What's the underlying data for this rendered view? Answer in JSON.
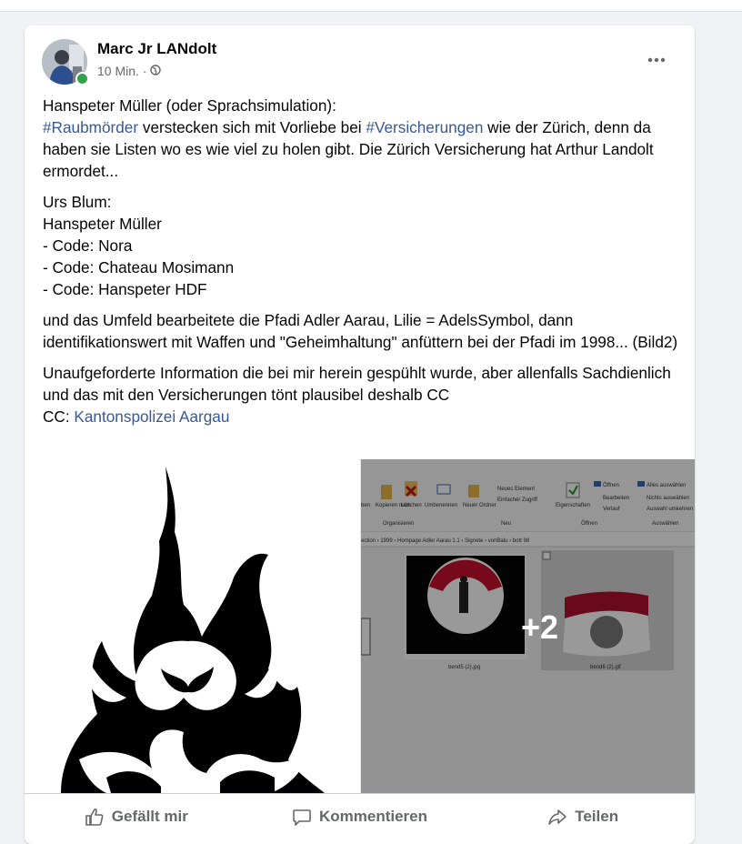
{
  "post": {
    "author": "Marc Jr LANdolt",
    "time": "10 Min. ·",
    "privacy_icon": "globe-icon",
    "paragraphs": [
      [
        {
          "text": "Hanspeter Müller (oder Sprachsimulation):",
          "type": "text"
        },
        {
          "type": "br"
        },
        {
          "text": "#Raubmörder",
          "type": "link"
        },
        {
          "text": " verstecken sich mit Vorliebe bei ",
          "type": "text"
        },
        {
          "text": "#Versicherungen",
          "type": "link"
        },
        {
          "text": " wie der Zürich, denn da haben sie Listen wo es wie viel zu holen gibt. Die Zürich Versicherung hat Arthur Landolt ermordet...",
          "type": "text"
        }
      ],
      [
        {
          "text": "Urs Blum:",
          "type": "text"
        },
        {
          "type": "br"
        },
        {
          "text": "Hanspeter Müller",
          "type": "text"
        },
        {
          "type": "br"
        },
        {
          "text": "- Code: Nora",
          "type": "text"
        },
        {
          "type": "br"
        },
        {
          "text": "- Code: Chateau Mosimann",
          "type": "text"
        },
        {
          "type": "br"
        },
        {
          "text": "- Code: Hanspeter HDF",
          "type": "text"
        }
      ],
      [
        {
          "text": "und das Umfeld bearbeitete die Pfadi Adler Aarau, Lilie = AdelsSymbol, dann identifikationswert mit Waffen und \"Geheimhaltung\" anfüttern bei der Pfadi im 1998... (Bild2)",
          "type": "text"
        }
      ],
      [
        {
          "text": "Unaufgeforderte Information die bei mir herein gespühlt wurde, aber allenfalls Sachdienlich und das mit den Versicherungen tönt plausibel deshalb CC",
          "type": "text"
        },
        {
          "type": "br"
        },
        {
          "text": "CC: ",
          "type": "text"
        },
        {
          "text": "Kantonspolizei Aargau",
          "type": "link"
        }
      ]
    ],
    "more_photos": "+2"
  },
  "screenshot_window": {
    "ribbon_items": [
      "ben",
      "Kopieren nach",
      "Löschen",
      "Umbenennen",
      "Neuer Ordner",
      "Neues Element",
      "Einfacher Zugriff",
      "Eigenschaften",
      "Öffnen",
      "Bearbeiten",
      "Verlauf",
      "Alles auswählen",
      "Nichts auswählen",
      "Auswahl umkehren"
    ],
    "ribbon_groups": [
      "Organisieren",
      "Neu",
      "Öffnen",
      "Auswählen"
    ],
    "path": "ection  ›  1999  ›  Hompage Adler Aarau 1.1  ›  Signete  ›  vonBalu  ›  bott 98",
    "file1": "bend5 (2).jpg",
    "file2": "bend6 (2).gif"
  },
  "actions": {
    "like": "Gefällt mir",
    "comment": "Kommentieren",
    "share": "Teilen"
  },
  "colors": {
    "link": "#385898",
    "muted": "#65676b",
    "online": "#31a24c"
  }
}
